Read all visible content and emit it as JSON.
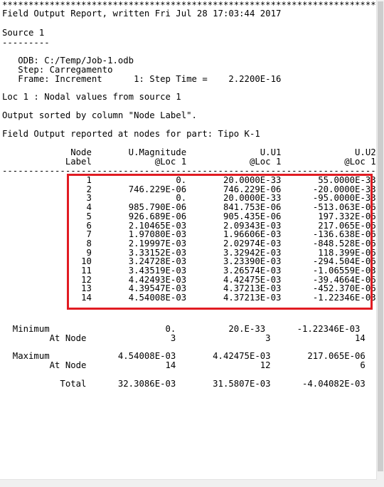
{
  "report": {
    "stars": "**********************************************************************************",
    "title": "Field Output Report, written Fri Jul 28 17:03:44 2017",
    "source_heading": "Source 1",
    "source_underline": "---------",
    "odb": "   ODB: C:/Temp/Job-1.odb",
    "step": "   Step: Carregamento",
    "frame": "   Frame: Increment      1: Step Time =    2.2200E-16",
    "loc": "Loc 1 : Nodal values from source 1",
    "sorted": "Output sorted by column \"Node Label\".",
    "field_output": "Field Output reported at nodes for part: Tipo K-1",
    "header1": "             Node       U.Magnitude              U.U1              U.U2",
    "header2": "            Label            @Loc 1            @Loc 1            @Loc 1",
    "dashes": "-------------------------------------------------------------------------------",
    "rows": [
      {
        "node": "1",
        "mag": "0.",
        "u1": "20.0000E-33",
        "u2": "55.0000E-33"
      },
      {
        "node": "2",
        "mag": "746.229E-06",
        "u1": "746.229E-06",
        "u2": "-20.0000E-33"
      },
      {
        "node": "3",
        "mag": "0.",
        "u1": "20.0000E-33",
        "u2": "-95.0000E-33"
      },
      {
        "node": "4",
        "mag": "985.790E-06",
        "u1": "841.753E-06",
        "u2": "-513.063E-06"
      },
      {
        "node": "5",
        "mag": "926.689E-06",
        "u1": "905.435E-06",
        "u2": "197.332E-06"
      },
      {
        "node": "6",
        "mag": "2.10465E-03",
        "u1": "2.09343E-03",
        "u2": "217.065E-06"
      },
      {
        "node": "7",
        "mag": "1.97080E-03",
        "u1": "1.96606E-03",
        "u2": "-136.638E-06"
      },
      {
        "node": "8",
        "mag": "2.19997E-03",
        "u1": "2.02974E-03",
        "u2": "-848.528E-06"
      },
      {
        "node": "9",
        "mag": "3.33152E-03",
        "u1": "3.32942E-03",
        "u2": "118.399E-06"
      },
      {
        "node": "10",
        "mag": "3.24728E-03",
        "u1": "3.23390E-03",
        "u2": "-294.504E-06"
      },
      {
        "node": "11",
        "mag": "3.43519E-03",
        "u1": "3.26574E-03",
        "u2": "-1.06559E-03"
      },
      {
        "node": "12",
        "mag": "4.42493E-03",
        "u1": "4.42475E-03",
        "u2": "-39.4664E-06"
      },
      {
        "node": "13",
        "mag": "4.39547E-03",
        "u1": "4.37213E-03",
        "u2": "-452.370E-06"
      },
      {
        "node": "14",
        "mag": "4.54008E-03",
        "u1": "4.37213E-03",
        "u2": "-1.22346E-03"
      }
    ],
    "minimum": "  Minimum                      0.          20.E-33      -1.22346E-03",
    "min_at": "         At Node                3                 3                14",
    "maximum": "  Maximum             4.54008E-03       4.42475E-03       217.065E-06",
    "max_at": "         At Node               14                12                 6",
    "total": "           Total      32.3086E-03       31.5807E-03      -4.04082E-03"
  },
  "highlight_color": "#e11b22"
}
